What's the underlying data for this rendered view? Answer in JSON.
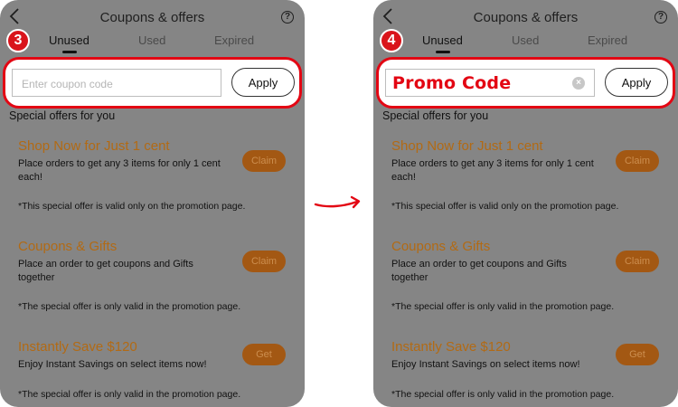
{
  "screens": [
    {
      "step": "3",
      "title": "Coupons & offers",
      "help": "?",
      "tabs": [
        "Unused",
        "Used",
        "Expired"
      ],
      "coupon_input": {
        "value": "",
        "placeholder": "Enter coupon code"
      },
      "apply_label": "Apply",
      "section_title": "Special offers for you",
      "offers": [
        {
          "title": "Shop Now for Just 1 cent",
          "desc": "Place orders to get any 3 items for only 1 cent each!",
          "note": "*This special offer is valid only on the promotion page.",
          "button": "Claim"
        },
        {
          "title": "Coupons & Gifts",
          "desc": "Place an order to get coupons and Gifts together",
          "note": "*The special offer is only valid in the promotion page.",
          "button": "Claim"
        },
        {
          "title": "Instantly Save $120",
          "desc": "Enjoy Instant Savings on select items now!",
          "note": "*The special offer is only valid in the promotion page.",
          "button": "Get"
        }
      ]
    },
    {
      "step": "4",
      "title": "Coupons & offers",
      "help": "?",
      "tabs": [
        "Unused",
        "Used",
        "Expired"
      ],
      "coupon_input": {
        "value": "Promo Code",
        "placeholder": ""
      },
      "clear_label": "×",
      "apply_label": "Apply",
      "section_title": "Special offers for you",
      "offers": [
        {
          "title": "Shop Now for Just 1 cent",
          "desc": "Place orders to get any 3 items for only 1 cent each!",
          "note": "*This special offer is valid only on the promotion page.",
          "button": "Claim"
        },
        {
          "title": "Coupons & Gifts",
          "desc": "Place an order to get coupons and Gifts together",
          "note": "*The special offer is only valid in the promotion page.",
          "button": "Claim"
        },
        {
          "title": "Instantly Save $120",
          "desc": "Enjoy Instant Savings on select items now!",
          "note": "*The special offer is only valid in the promotion page.",
          "button": "Get"
        }
      ]
    }
  ],
  "colors": {
    "highlight": "#e30613",
    "offer_title": "#b26a14",
    "claim_button": "#a35813",
    "overlay": "#858585"
  },
  "icons": {
    "back": "chevron-left-icon",
    "help": "help-circle-icon",
    "clear": "clear-circle-icon",
    "arrow": "curved-arrow-right-icon"
  }
}
